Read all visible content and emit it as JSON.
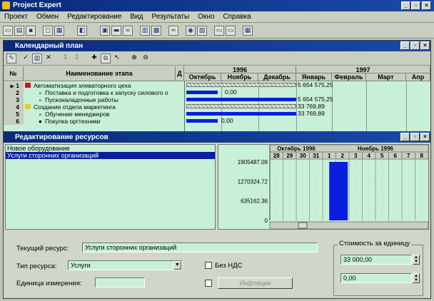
{
  "app": {
    "title": "Project Expert",
    "menu": [
      "Проект",
      "Обмен",
      "Редактирование",
      "Вид",
      "Результаты",
      "Окно",
      "Справка"
    ]
  },
  "toolbar_icons": [
    "new-icon",
    "open-icon",
    "save-icon",
    "preview-icon",
    "print-icon",
    "exit-icon",
    "calc-icon",
    "folder-icon",
    "binoculars-icon",
    "chart-icon",
    "table-icon",
    "graph-icon",
    "gear-icon",
    "report-icon",
    "window-icon",
    "window2-icon",
    "build-icon"
  ],
  "calendar": {
    "title": "Календарный план",
    "header": {
      "num": "№",
      "name": "Наименование этапа",
      "col_j": "Д",
      "years": [
        "1996",
        "1997"
      ],
      "months": [
        "Октябрь",
        "Ноябрь",
        "Декабрь",
        "Январь",
        "Февраль",
        "Март",
        "Апр"
      ]
    },
    "rows": [
      {
        "n": "1",
        "name": "Автоматизация элеваторного цеха",
        "value": "5 654 575,25",
        "type": "group"
      },
      {
        "n": "2",
        "name": "Поставка и подготовка к запуску силового о",
        "value": "0,00",
        "type": "task"
      },
      {
        "n": "3",
        "name": "Пусконаладочные работы",
        "value": "5 654 575,25",
        "type": "task"
      },
      {
        "n": "4",
        "name": "Создание отдела маркетинга",
        "value": "33 769,89",
        "type": "group"
      },
      {
        "n": "5",
        "name": "Обучение менеджеров",
        "value": "33 769,89",
        "type": "task"
      },
      {
        "n": "6",
        "name": "Покупка оргтехники",
        "value": "0,00",
        "type": "task"
      }
    ]
  },
  "resources": {
    "title": "Редактирование ресурсов",
    "list": [
      "Новое оборудование",
      "Услуги сторонних организаций"
    ],
    "selected_index": 1,
    "chart": {
      "y_ticks": [
        "1905487.09",
        "1270324.72",
        "635162.36",
        "0"
      ],
      "months": [
        "Октябрь 1996",
        "Ноябрь 1996"
      ],
      "days": [
        "28",
        "29",
        "30",
        "31",
        "1",
        "2",
        "3",
        "4",
        "5",
        "6",
        "7",
        "8"
      ]
    },
    "form": {
      "current_label": "Текущий ресурс:",
      "current_value": "Услуги сторонних организаций",
      "type_label": "Тип ресурса:",
      "type_value": "Услуги",
      "no_vat_label": "Без НДС",
      "unit_label": "Единица измерения:",
      "unit_value": "",
      "inflation_label": "Инфляция",
      "cost_label": "Стоимость за единицу",
      "cost_value": "33 000,00",
      "cost_value2": "0,00"
    }
  },
  "chart_data": {
    "type": "bar",
    "categories": [
      "28",
      "29",
      "30",
      "31",
      "1",
      "2",
      "3",
      "4",
      "5",
      "6",
      "7",
      "8"
    ],
    "values": [
      0,
      0,
      0,
      0,
      1905487.09,
      0,
      0,
      0,
      0,
      0,
      0,
      0
    ],
    "ylim": [
      0,
      1905487.09
    ]
  }
}
